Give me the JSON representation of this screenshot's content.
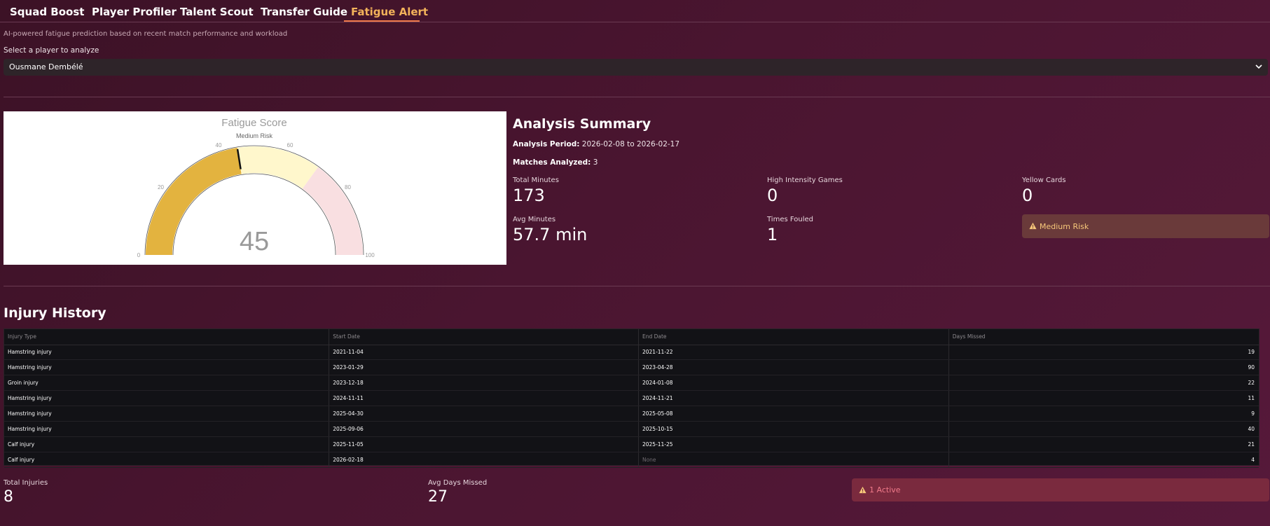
{
  "tabs": [
    {
      "label": "Squad Boost"
    },
    {
      "label": "Player Profiler"
    },
    {
      "label": "Talent Scout"
    },
    {
      "label": "Transfer Guide"
    },
    {
      "label": "Fatigue Alert"
    }
  ],
  "active_tab": "Fatigue Alert",
  "subtitle": "AI-powered fatigue prediction based on recent match performance and workload",
  "player_select": {
    "label": "Select a player to analyze",
    "value": "Ousmane Dembélé"
  },
  "gauge": {
    "title": "Fatigue Score",
    "subtitle": "Medium Risk",
    "value": 45,
    "min": 0,
    "max": 100,
    "ticks": [
      "0",
      "20",
      "40",
      "60",
      "80",
      "100"
    ],
    "bands": [
      {
        "from": 0,
        "to": 45,
        "color": "#e3b33f"
      },
      {
        "from": 45,
        "to": 70,
        "color": "#fff7cc"
      },
      {
        "from": 70,
        "to": 100,
        "color": "#f9dfe1"
      }
    ]
  },
  "summary": {
    "title": "Analysis Summary",
    "period_label": "Analysis Period:",
    "period_value": "2026-02-08 to 2026-02-17",
    "matches_label": "Matches Analyzed:",
    "matches_value": "3",
    "metrics": [
      {
        "label": "Total Minutes",
        "value": "173"
      },
      {
        "label": "High Intensity Games",
        "value": "0"
      },
      {
        "label": "Yellow Cards",
        "value": "0"
      },
      {
        "label": "Avg Minutes",
        "value": "57.7 min"
      },
      {
        "label": "Times Fouled",
        "value": "1"
      }
    ],
    "risk_badge": "Medium Risk",
    "risk_color": "#f7c87a"
  },
  "injury": {
    "title": "Injury History",
    "columns": [
      "Injury Type",
      "Start Date",
      "End Date",
      "Days Missed"
    ],
    "rows": [
      [
        "Hamstring injury",
        "2021-11-04",
        "2021-11-22",
        "19"
      ],
      [
        "Hamstring injury",
        "2023-01-29",
        "2023-04-28",
        "90"
      ],
      [
        "Groin injury",
        "2023-12-18",
        "2024-01-08",
        "22"
      ],
      [
        "Hamstring injury",
        "2024-11-11",
        "2024-11-21",
        "11"
      ],
      [
        "Hamstring injury",
        "2025-04-30",
        "2025-05-08",
        "9"
      ],
      [
        "Hamstring injury",
        "2025-09-06",
        "2025-10-15",
        "40"
      ],
      [
        "Calf injury",
        "2025-11-05",
        "2025-11-25",
        "21"
      ],
      [
        "Calf injury",
        "2026-02-18",
        "None",
        "4"
      ]
    ],
    "stats": [
      {
        "label": "Total Injuries",
        "value": "8"
      },
      {
        "label": "Avg Days Missed",
        "value": "27"
      }
    ],
    "active_badge": "1 Active"
  },
  "colors": {
    "accent_tab": "#f2b25a",
    "gauge_fill": "#e3b33f",
    "warning": "#f7c87a",
    "active_alert": "#f07a8a"
  }
}
